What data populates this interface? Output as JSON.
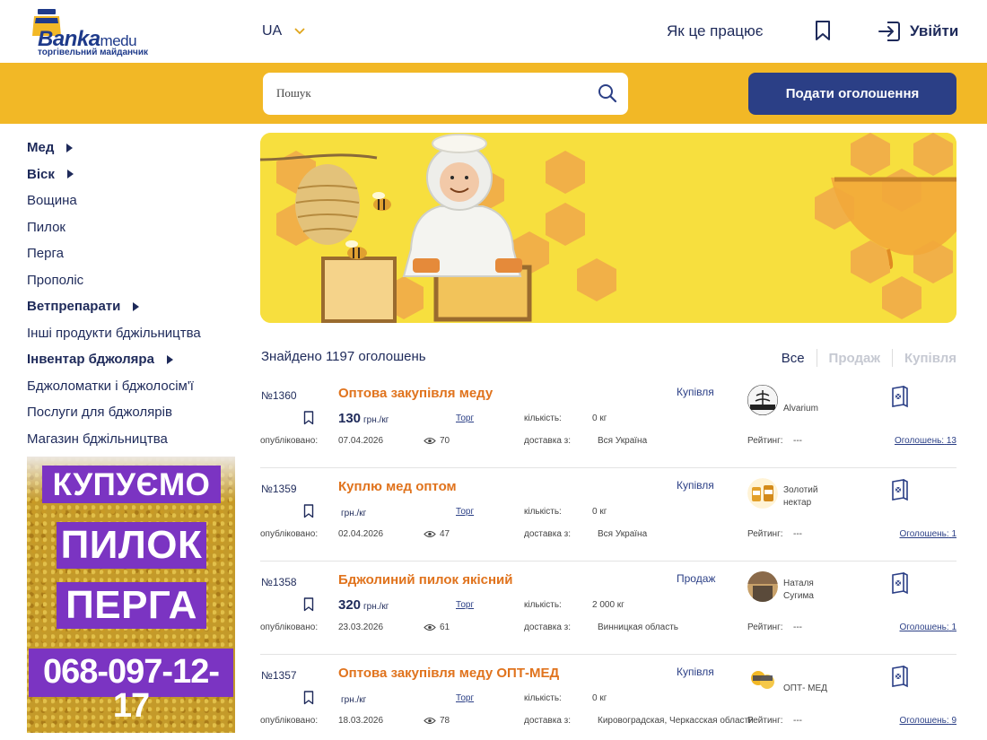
{
  "header": {
    "logo": {
      "brand": "Banka",
      "brand_sub": "medu",
      "tagline": "торгівельний майданчик"
    },
    "language": "UA",
    "how_it_works": "Як це працює",
    "login": "Увійти"
  },
  "search": {
    "placeholder": "Пошук"
  },
  "post_button": "Подати оголошення",
  "sidebar": {
    "categories": [
      {
        "label": "Мед",
        "bold": true,
        "has_sub": true
      },
      {
        "label": "Віск",
        "bold": true,
        "has_sub": true
      },
      {
        "label": "Вощина",
        "bold": false,
        "has_sub": false
      },
      {
        "label": "Пилок",
        "bold": false,
        "has_sub": false
      },
      {
        "label": "Перга",
        "bold": false,
        "has_sub": false
      },
      {
        "label": "Прополіс",
        "bold": false,
        "has_sub": false
      },
      {
        "label": "Ветпрепарати",
        "bold": true,
        "has_sub": true
      },
      {
        "label": "Інші продукти бджільництва",
        "bold": false,
        "has_sub": false
      },
      {
        "label": "Інвентар бджоляра",
        "bold": true,
        "has_sub": true
      },
      {
        "label": "Бджоломатки і бджолосім'ї",
        "bold": false,
        "has_sub": false
      },
      {
        "label": "Послуги для бджолярів",
        "bold": false,
        "has_sub": false
      },
      {
        "label": "Магазин бджільництва",
        "bold": false,
        "has_sub": false
      }
    ]
  },
  "promo": {
    "line1": "КУПУЄМО",
    "line2": "ПИЛОК",
    "line3": "ПЕРГА",
    "phone": "068-097-12-17"
  },
  "listings_header": {
    "found": "Знайдено 1197 оголошень",
    "filters": [
      "Все",
      "Продаж",
      "Купівля"
    ],
    "active_filter": "Все"
  },
  "labels": {
    "published": "опубліковано:",
    "quantity": "кількість:",
    "delivery": "доставка з:",
    "rating": "Рейтинг:",
    "bargain": "Торг",
    "announcements_prefix": "Оголошень:"
  },
  "listings": [
    {
      "num": "№1360",
      "title": "Оптова закупівля меду",
      "type": "Купівля",
      "price": "130",
      "unit": "грн./кг",
      "quantity": "0 кг",
      "published": "07.04.2026",
      "views": "70",
      "delivery": "Вся Україна",
      "seller": "Alvarium",
      "avatar": "alvarium",
      "rating": "---",
      "announcements": "13"
    },
    {
      "num": "№1359",
      "title": "Куплю мед оптом",
      "type": "Купівля",
      "price": "",
      "unit": "грн./кг",
      "quantity": "0 кг",
      "published": "02.04.2026",
      "views": "47",
      "delivery": "Вся Україна",
      "seller": "Золотий нектар",
      "avatar": "honey-jars",
      "rating": "---",
      "announcements": "1"
    },
    {
      "num": "№1358",
      "title": "Бджолиний пилок якісний",
      "type": "Продаж",
      "price": "320",
      "unit": "грн./кг",
      "quantity": "2 000 кг",
      "published": "23.03.2026",
      "views": "61",
      "delivery": "Винницкая область",
      "seller": "Наталя Сугима",
      "avatar": "photo",
      "rating": "---",
      "announcements": "1"
    },
    {
      "num": "№1357",
      "title": "Оптова закупівля меду ОПТ-МЕД",
      "type": "Купівля",
      "price": "",
      "unit": "грн./кг",
      "quantity": "0 кг",
      "published": "18.03.2026",
      "views": "78",
      "delivery": "Кировоградская, Черкасская области",
      "seller": "ОПТ- МЕД",
      "avatar": "opt-med",
      "rating": "---",
      "announcements": "9"
    }
  ],
  "colors": {
    "primary": "#2b3f86",
    "accent": "#f2b826",
    "title_orange": "#e0731d",
    "promo_purple": "#7b34c2"
  }
}
